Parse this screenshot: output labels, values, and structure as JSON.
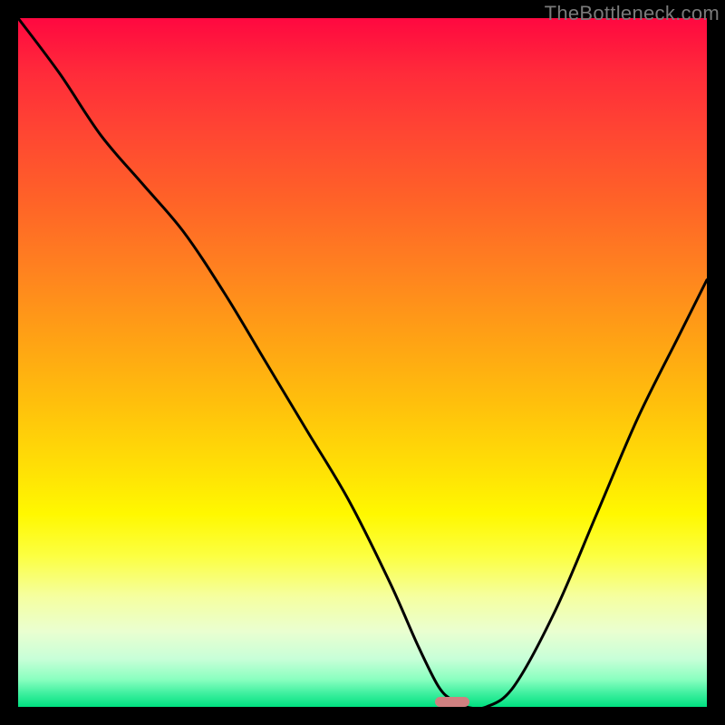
{
  "watermark": "TheBottleneck.com",
  "chart_data": {
    "type": "line",
    "title": "",
    "xlabel": "",
    "ylabel": "",
    "xlim": [
      0,
      100
    ],
    "ylim": [
      0,
      100
    ],
    "grid": false,
    "background_gradient": {
      "top": "#ff0840",
      "bottom": "#00e080",
      "description": "vertical gradient red→orange→yellow→green"
    },
    "series": [
      {
        "name": "bottleneck-curve",
        "x": [
          0,
          6,
          12,
          18,
          24,
          30,
          36,
          42,
          48,
          54,
          58,
          61,
          63,
          65,
          68,
          72,
          78,
          84,
          90,
          96,
          100
        ],
        "y": [
          100,
          92,
          83,
          76,
          69,
          60,
          50,
          40,
          30,
          18,
          9,
          3,
          1,
          0,
          0,
          3,
          14,
          28,
          42,
          54,
          62
        ],
        "color": "#000000",
        "width": 3
      }
    ],
    "marker": {
      "name": "optimal-point",
      "x": 63,
      "y": 0,
      "width": 5,
      "height": 1.5,
      "color": "#d08080"
    }
  }
}
